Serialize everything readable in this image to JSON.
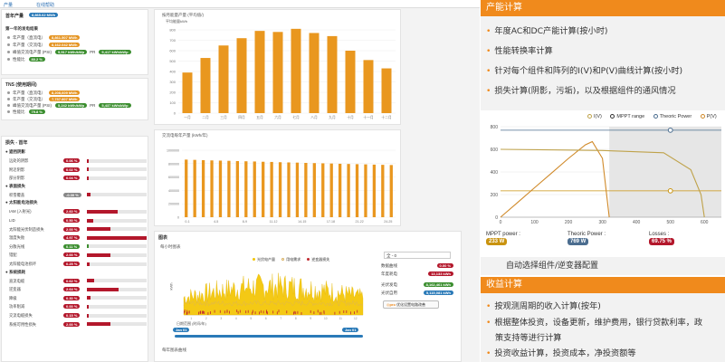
{
  "topbar": {
    "crumb1": "产量",
    "crumb2": "在线帮助"
  },
  "panel1": {
    "title": "首年产量",
    "head_value": "8,865.62 MWh",
    "sub1": "第一年的发电结果",
    "rows": [
      {
        "label": "年产量（直流电）",
        "value": "8,861.507 MWh",
        "color": "orange"
      },
      {
        "label": "年产量（交流电）",
        "value": "8,162.042 MWh",
        "color": "orange"
      },
      {
        "label": "峰值交流电产量 (PSI)",
        "value": "5,517 kWh/kWp",
        "extra_label": "PR",
        "extra": "5,417 kWh/kWp",
        "color": "green"
      },
      {
        "label": "性能比",
        "value": "80.2 %",
        "color": "green"
      }
    ]
  },
  "panel2": {
    "title": "TNS (使用期间)",
    "rows": [
      {
        "label": "年产量（直流电）",
        "value": "8,208,609 MWh",
        "color": "orange"
      },
      {
        "label": "年产量（交流电）",
        "value": "7,737.807 MWh",
        "color": "orange"
      },
      {
        "label": "峰值交流电产量 (PSI)",
        "value": "5,242 kWh/kWp",
        "extra_label": "PR",
        "extra": "5,437 kWh/kWp",
        "color": "green"
      },
      {
        "label": "性能比",
        "value": "79.8 %",
        "color": "green"
      }
    ]
  },
  "losses": {
    "title": "损失 - 首年",
    "sections": [
      {
        "name": "遮挡阴影",
        "items": [
          {
            "label": "远处的阴影",
            "value": "0.06 %",
            "pct": 0.06
          },
          {
            "label": "附近阴影",
            "value": "0.02 %",
            "pct": 0.02
          },
          {
            "label": "部分阴影",
            "value": "0.04 %",
            "pct": 0.04
          }
        ]
      },
      {
        "name": "表面损失",
        "items": [
          {
            "label": "积雪覆盖",
            "value": "-0.30 %",
            "pct": 0.3,
            "grey": true
          }
        ]
      },
      {
        "name": "太阳能电池损失",
        "items": [
          {
            "label": "IAM (入射光)",
            "value": "2.60 %",
            "pct": 2.6
          },
          {
            "label": "LID",
            "value": "0.50 %",
            "pct": 0.5
          },
          {
            "label": "太阳能光伏制造损失",
            "value": "2.00 %",
            "pct": 2.0
          },
          {
            "label": "温度失败",
            "value": "4.97 %",
            "pct": 4.97
          },
          {
            "label": "分散光线",
            "value": "0.11 %",
            "pct": 0.11,
            "green": true
          },
          {
            "label": "错配",
            "value": "2.00 %",
            "pct": 2.0
          },
          {
            "label": "太阳能电池损坏",
            "value": "0.25 %",
            "pct": 0.25
          }
        ]
      },
      {
        "name": "系统损耗",
        "items": [
          {
            "label": "直流电缆",
            "value": "0.62 %",
            "pct": 0.62
          },
          {
            "label": "逆变器",
            "value": "2.64 %",
            "pct": 2.64
          },
          {
            "label": "降级",
            "value": "0.30 %",
            "pct": 0.3
          },
          {
            "label": "功率削减",
            "value": "0.00 %",
            "pct": 0.0
          },
          {
            "label": "交流电缆损失",
            "value": "0.15 %",
            "pct": 0.15
          },
          {
            "label": "系统可用性损失",
            "value": "2.00 %",
            "pct": 2.0
          }
        ]
      }
    ]
  },
  "chart_monthly": {
    "title": "按月能量产量 (平均值/)",
    "subtitle": "平均能量kWh",
    "chart_data": {
      "type": "bar",
      "categories": [
        "一月",
        "二月",
        "三月",
        "四月",
        "五月",
        "六月",
        "七月",
        "八月",
        "九月",
        "十月",
        "十一月",
        "十二月"
      ],
      "values": [
        390,
        530,
        650,
        720,
        790,
        780,
        810,
        770,
        740,
        600,
        510,
        430
      ],
      "ylim": [
        0,
        800
      ],
      "yticks": [
        "0",
        "100",
        "200",
        "300",
        "400",
        "500",
        "600",
        "700",
        "800"
      ]
    }
  },
  "chart_yearly": {
    "title": "交流电每年产量 (kWh/年)",
    "chart_data": {
      "type": "bar",
      "values": [
        860000,
        856000,
        852000,
        848000,
        845000,
        842000,
        838000,
        835000,
        832000,
        828000,
        825000,
        821000,
        818000,
        815000,
        811000,
        808000,
        805000,
        802000,
        798000,
        795000,
        792000,
        789000,
        785000,
        782000,
        779000
      ],
      "ylim": [
        0,
        1000000
      ],
      "yticks": [
        "0",
        "200000",
        "400000",
        "600000",
        "800000",
        "1000000"
      ],
      "xticks": [
        "0-1",
        "4-5",
        "8-9",
        "11-12",
        "14-15",
        "17-18",
        "21-22",
        "24-25"
      ]
    }
  },
  "chart_hourly": {
    "panel_title": "图表",
    "title": "每小时图表",
    "legend": [
      "光伏电产量",
      "用电需求",
      "逆变器损失"
    ],
    "ylabel": "kWh",
    "range_label": "日期范围 (时间/年)",
    "range_start": "Jan 01",
    "range_end": "Jan 01",
    "bottom_title": "每年图表曲线",
    "side": {
      "select_value": "全 - 0",
      "rows": [
        {
          "label": "数据曲线",
          "value": "0.00 %"
        },
        {
          "label": "年度耗电",
          "value": "13,133 kWh"
        },
        {
          "label": "光伏发电",
          "value": "8,162,461 kWh"
        },
        {
          "label": "光伏自用",
          "value": "5,115,081 kWh"
        }
      ],
      "button": "优化设置电路改善"
    }
  },
  "right": {
    "section1_title": "产能计算",
    "section1_items": [
      "年度AC和DC产能计算(按小时)",
      "性能转换率计算",
      "针对每个组件和阵列的I(V)和P(V)曲线计算(按小时)",
      "损失计算(阴影，污垢)，以及根据组件的通风情况"
    ],
    "iv_chart": {
      "legend": [
        "I(V)",
        "MPPT range",
        "Theoric Power",
        "P(V)"
      ],
      "yticks": [
        "0",
        "200",
        "400",
        "600",
        "800"
      ],
      "xticks": [
        "0",
        "100",
        "200",
        "300",
        "400",
        "500",
        "600"
      ],
      "chart_data": {
        "type": "line",
        "series": [
          {
            "name": "P(V)",
            "x": [
              0,
              50,
              100,
              150,
              200,
              250,
              270,
              300,
              320
            ],
            "y": [
              0,
              130,
              260,
              390,
              520,
              640,
              668,
              520,
              0
            ]
          },
          {
            "name": "I(V)",
            "x": [
              0,
              300,
              480,
              560,
              590,
              600
            ],
            "y": [
              600,
              590,
              570,
              420,
              200,
              0
            ]
          }
        ],
        "xlim": [
          0,
          650
        ],
        "ylim": [
          0,
          800
        ]
      }
    },
    "stats": [
      {
        "label": "MPPT power :",
        "value": "233 W",
        "color": "#c9930f"
      },
      {
        "label": "Theoric Power :",
        "value": "769 W",
        "color": "#4b6d8f"
      },
      {
        "label": "Losses :",
        "value": "69.75 %",
        "color": "#b3172b"
      }
    ],
    "iv_caption": "自动选择组件/逆变器配置",
    "section2_title": "收益计算",
    "section2_items": [
      "按观测周期的收入计算(按年)",
      "根据整体投资，设备更新，维护费用，银行贷款利率，政",
      "策支持等进行计算",
      "投资收益计算，投资成本，净投资额等"
    ]
  }
}
